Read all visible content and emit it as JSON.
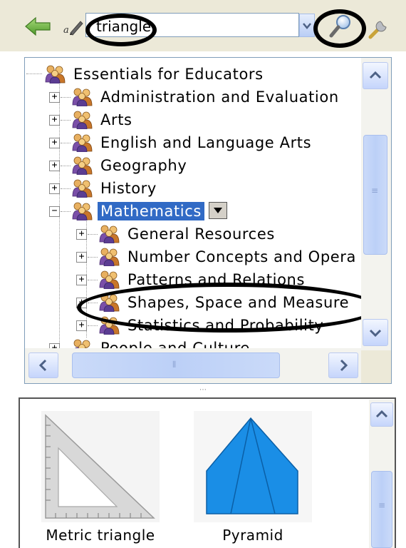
{
  "search": {
    "value": "triangle"
  },
  "tree": {
    "root": "Essentials for Educators",
    "items": [
      "Administration and Evaluation",
      "Arts",
      "English and Language Arts",
      "Geography",
      "History",
      "Mathematics",
      "People and Culture"
    ],
    "math_children": [
      "General Resources",
      "Number Concepts and Opera",
      "Patterns and Relations",
      "Shapes, Space and Measure",
      "Statistics and Probability"
    ],
    "selected": "Mathematics"
  },
  "gallery": {
    "items": [
      {
        "label": "Metric triangle"
      },
      {
        "label": "Pyramid"
      }
    ]
  },
  "icons": {
    "back": "back-arrow-icon",
    "spell": "spell-check-icon",
    "dropdown": "chevron-down-icon",
    "search": "magnifier-icon",
    "tool": "tool-icon",
    "category": "people-group-icon"
  },
  "colors": {
    "selection": "#316ac5",
    "chrome": "#ece9d8",
    "pyramid": "#1a8ee6",
    "annotation": "#000000"
  }
}
